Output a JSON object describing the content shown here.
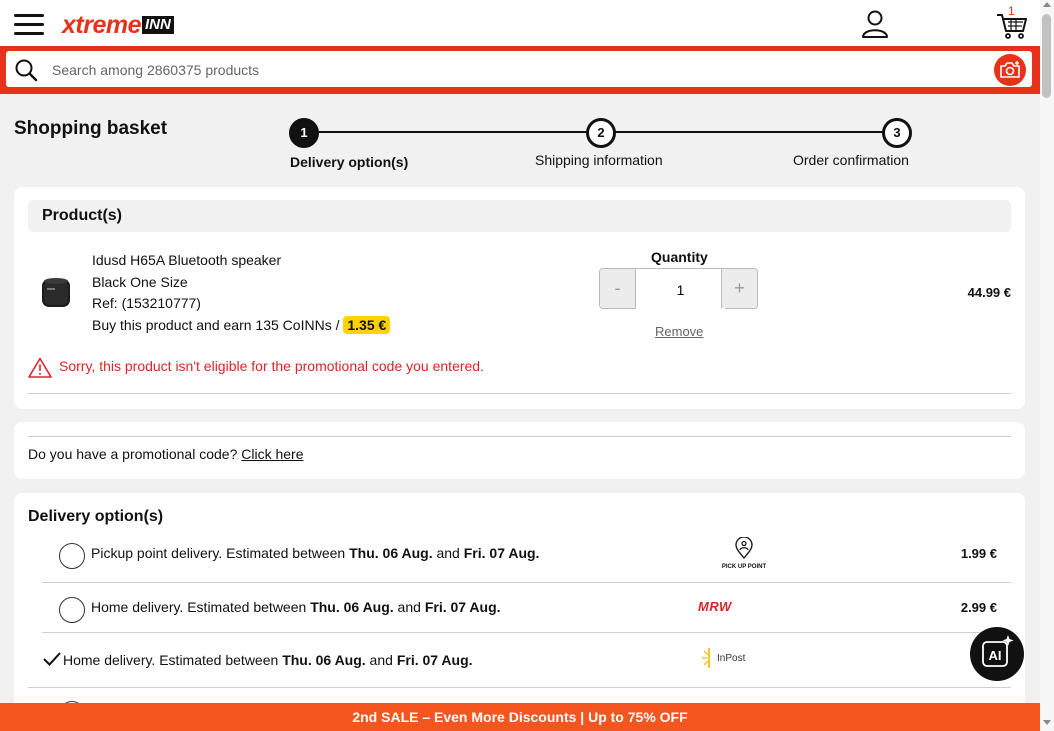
{
  "header": {
    "logo_main": "xtreme",
    "logo_suffix": "INN",
    "cart_count": "1"
  },
  "search": {
    "placeholder": "Search among 2860375 products"
  },
  "page": {
    "title": "Shopping basket"
  },
  "steps": [
    {
      "number": "1",
      "label": "Delivery option(s)",
      "active": true
    },
    {
      "number": "2",
      "label": "Shipping information",
      "active": false
    },
    {
      "number": "3",
      "label": "Order confirmation",
      "active": false
    }
  ],
  "products": {
    "header": "Product(s)",
    "item": {
      "name": "Idusd H65A Bluetooth speaker",
      "variant": "Black One Size",
      "ref": "Ref: (153210777)",
      "earn_text": "Buy this product and earn 135 CoINNs / ",
      "earn_value": "1.35 €",
      "quantity_label": "Quantity",
      "quantity": "1",
      "minus": "-",
      "plus": "+",
      "remove": "Remove",
      "price": "44.99 €"
    },
    "warning": "Sorry, this product isn't eligible for the promotional code you entered."
  },
  "promo": {
    "text": "Do you have a promotional code? ",
    "link": "Click here"
  },
  "delivery": {
    "title": "Delivery option(s)",
    "options": [
      {
        "prefix": "Pickup point delivery. Estimated between ",
        "date1": "Thu. 06 Aug.",
        "and": " and ",
        "date2": "Fri. 07 Aug.",
        "carrier": "PICK UP POINT",
        "price": "1.99 €",
        "selected": false
      },
      {
        "prefix": "Home delivery. Estimated between ",
        "date1": "Thu. 06 Aug.",
        "and": " and ",
        "date2": "Fri. 07 Aug.",
        "carrier": "MRW",
        "price": "2.99 €",
        "selected": false
      },
      {
        "prefix": "Home delivery. Estimated between ",
        "date1": "Thu. 06 Aug.",
        "and": " and ",
        "date2": "Fri. 07 Aug.",
        "carrier": "InPost",
        "price": "",
        "selected": true
      }
    ]
  },
  "banner": {
    "text": "2nd SALE – Even More Discounts | Up to 75% OFF"
  },
  "ai_button": {
    "label": "AI"
  },
  "colors": {
    "brand": "#e8311b",
    "banner": "#f5551f",
    "warning": "#d8262b",
    "coin_badge": "#ffd200"
  }
}
